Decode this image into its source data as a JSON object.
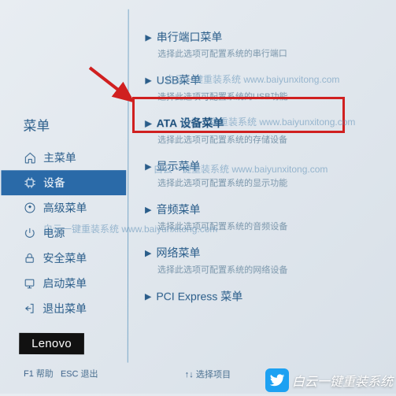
{
  "sidebar": {
    "title": "菜单",
    "items": [
      {
        "icon": "home",
        "label": "主菜单"
      },
      {
        "icon": "chip",
        "label": "设备"
      },
      {
        "icon": "sliders",
        "label": "高级菜单"
      },
      {
        "icon": "power",
        "label": "电源"
      },
      {
        "icon": "lock",
        "label": "安全菜单"
      },
      {
        "icon": "boot",
        "label": "启动菜单"
      },
      {
        "icon": "exit",
        "label": "退出菜单"
      }
    ]
  },
  "right": {
    "items": [
      {
        "label": "串行端口菜单",
        "desc": "选择此选项可配置系统的串行端口"
      },
      {
        "label": "USB菜单",
        "desc": "选择此选项可配置系统的USB功能"
      },
      {
        "label": "ATA 设备菜单",
        "desc": "选择此选项可配置系统的存储设备"
      },
      {
        "label": "显示菜单",
        "desc": "选择此选项可配置系统的显示功能"
      },
      {
        "label": "音频菜单",
        "desc": "选择此选项可配置系统的音频设备"
      },
      {
        "label": "网络菜单",
        "desc": "选择此选项可配置系统的网络设备"
      },
      {
        "label": "PCI Express 菜单",
        "desc": ""
      }
    ]
  },
  "brand": "Lenovo",
  "footer": {
    "help_key": "F1",
    "help_label": "帮助",
    "exit_key": "ESC",
    "exit_label": "退出",
    "nav_key": "↑↓",
    "nav_label": "选择项目"
  },
  "watermark": "白云一键重装系统 www.baiyunxitong.com",
  "promo_text": "白云一键重装系统"
}
